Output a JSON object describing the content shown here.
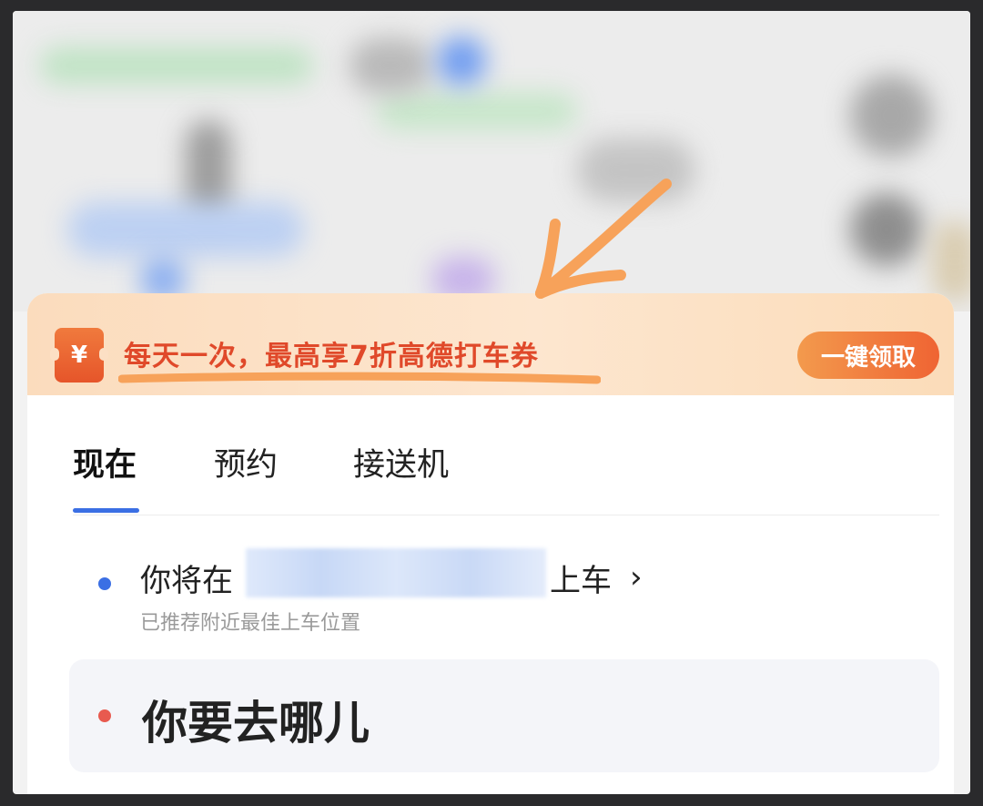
{
  "promo": {
    "icon_glyph": "¥",
    "text": "每天一次，最高享7折高德打车券",
    "button_label": "一键领取",
    "colors": {
      "text": "#e0492a",
      "button": "#ef6433"
    }
  },
  "tabs": [
    {
      "label": "现在",
      "active": true
    },
    {
      "label": "预约",
      "active": false
    },
    {
      "label": "接送机",
      "active": false
    }
  ],
  "pickup": {
    "prefix": "你将在",
    "suffix": "上车",
    "chevron": "›",
    "hint": "已推荐附近最佳上车位置",
    "dot_color": "#3b6fe4"
  },
  "destination": {
    "placeholder": "你要去哪儿",
    "dot_color": "#e85a4f"
  },
  "accent_color": "#3b6fe4"
}
